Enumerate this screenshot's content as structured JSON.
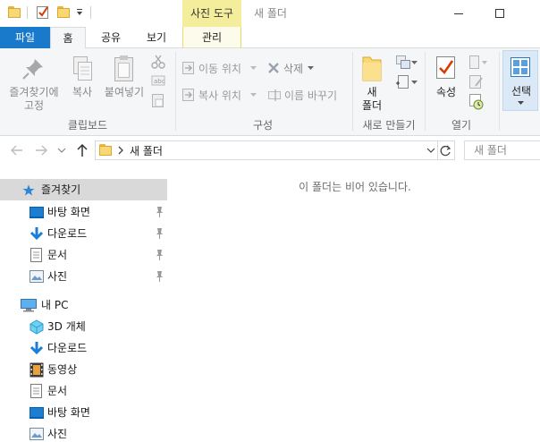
{
  "window": {
    "contextual_tab_title": "사진 도구",
    "title": "새 폴더"
  },
  "ribbon_tabs": {
    "file": "파일",
    "home": "홈",
    "share": "공유",
    "view": "보기",
    "manage": "관리"
  },
  "clipboard": {
    "pin_quick_access": [
      "즐겨찾기에",
      "고정"
    ],
    "copy": "복사",
    "paste": "붙여넣기",
    "group_label": "클립보드"
  },
  "organize": {
    "move_to": "이동 위치",
    "copy_to": "복사 위치",
    "delete": "삭제",
    "rename": "이름 바꾸기",
    "group_label": "구성"
  },
  "new": {
    "new_folder": [
      "새",
      "폴더"
    ],
    "group_label": "새로 만들기"
  },
  "open": {
    "properties": "속성",
    "group_label": "열기"
  },
  "select": {
    "select": "선택"
  },
  "address": {
    "path": "새 폴더",
    "search_placeholder": "새 폴더"
  },
  "nav_pane": {
    "quick_access": "즐겨찾기",
    "quick_items": [
      "바탕 화면",
      "다운로드",
      "문서",
      "사진"
    ],
    "this_pc": "내 PC",
    "pc_items": [
      "3D 개체",
      "다운로드",
      "동영상",
      "문서",
      "바탕 화면",
      "사진"
    ]
  },
  "content": {
    "empty_message": "이 폴더는 비어 있습니다."
  }
}
